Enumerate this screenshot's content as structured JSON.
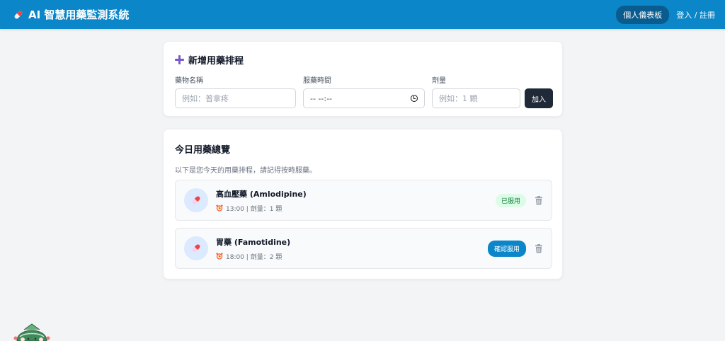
{
  "header": {
    "title": "AI 智慧用藥監測系統",
    "dashboard_label": "個人儀表板",
    "login_label": "登入 / 註冊"
  },
  "add_form": {
    "title": "新增用藥排程",
    "name_label": "藥物名稱",
    "name_placeholder": "例如：普拿疼",
    "time_label": "服藥時間",
    "time_value": "-- --:--",
    "dose_label": "劑量",
    "dose_placeholder": "例如：1 顆",
    "add_label": "加入"
  },
  "today": {
    "title": "今日用藥總覽",
    "subtitle": "以下是您今天的用藥排程，請記得按時服藥。",
    "items": [
      {
        "name": "高血壓藥 (Amlodipine)",
        "meta": "13:00 | 劑量：1 顆",
        "status": "已服用"
      },
      {
        "name": "胃藥 (Famotidine)",
        "meta": "18:00 | 劑量：2 顆",
        "action": "確認服用"
      }
    ]
  },
  "colors": {
    "header_bg": "#0b86c8",
    "dashboard_bg": "#0a5c8e",
    "add_button": "#1f2937",
    "taken_badge_bg": "#dcfce7",
    "taken_badge_text": "#15803d",
    "confirm_button": "#0b86c8"
  },
  "icons": {
    "brand": "pill-icon",
    "add": "plus-icon",
    "time": "clock-icon",
    "medicine": "pill-icon",
    "meta": "alarm-clock-icon",
    "delete": "trash-icon"
  }
}
